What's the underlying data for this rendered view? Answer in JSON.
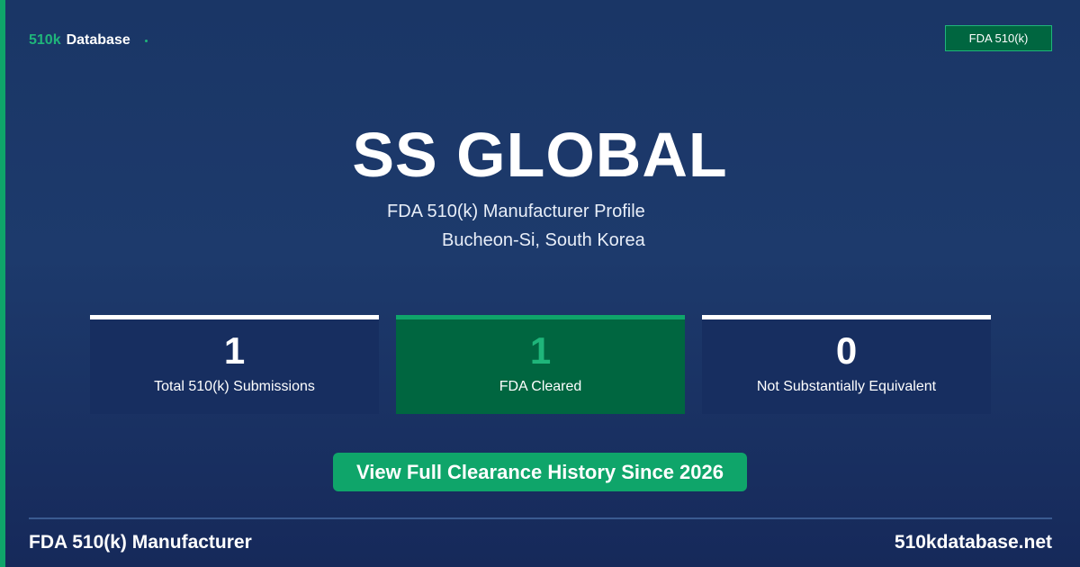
{
  "brand": {
    "prefix": "510k",
    "name": "Database"
  },
  "badge": "FDA 510(k)",
  "company": {
    "name": "SS GLOBAL",
    "subtitle": "FDA 510(k) Manufacturer Profile",
    "location": "Bucheon-Si, South Korea"
  },
  "stats": [
    {
      "value": "1",
      "label": "Total 510(k) Submissions"
    },
    {
      "value": "1",
      "label": "FDA Cleared"
    },
    {
      "value": "0",
      "label": "Not Substantially Equivalent"
    }
  ],
  "cta": "View Full Clearance History Since 2026",
  "footer": {
    "left": "FDA 510(k) Manufacturer",
    "right": "510kdatabase.net"
  },
  "colors": {
    "background": "#1d3a6c",
    "accent": "#0fa56a",
    "accent_dark": "#006640",
    "card": "#172e60"
  }
}
